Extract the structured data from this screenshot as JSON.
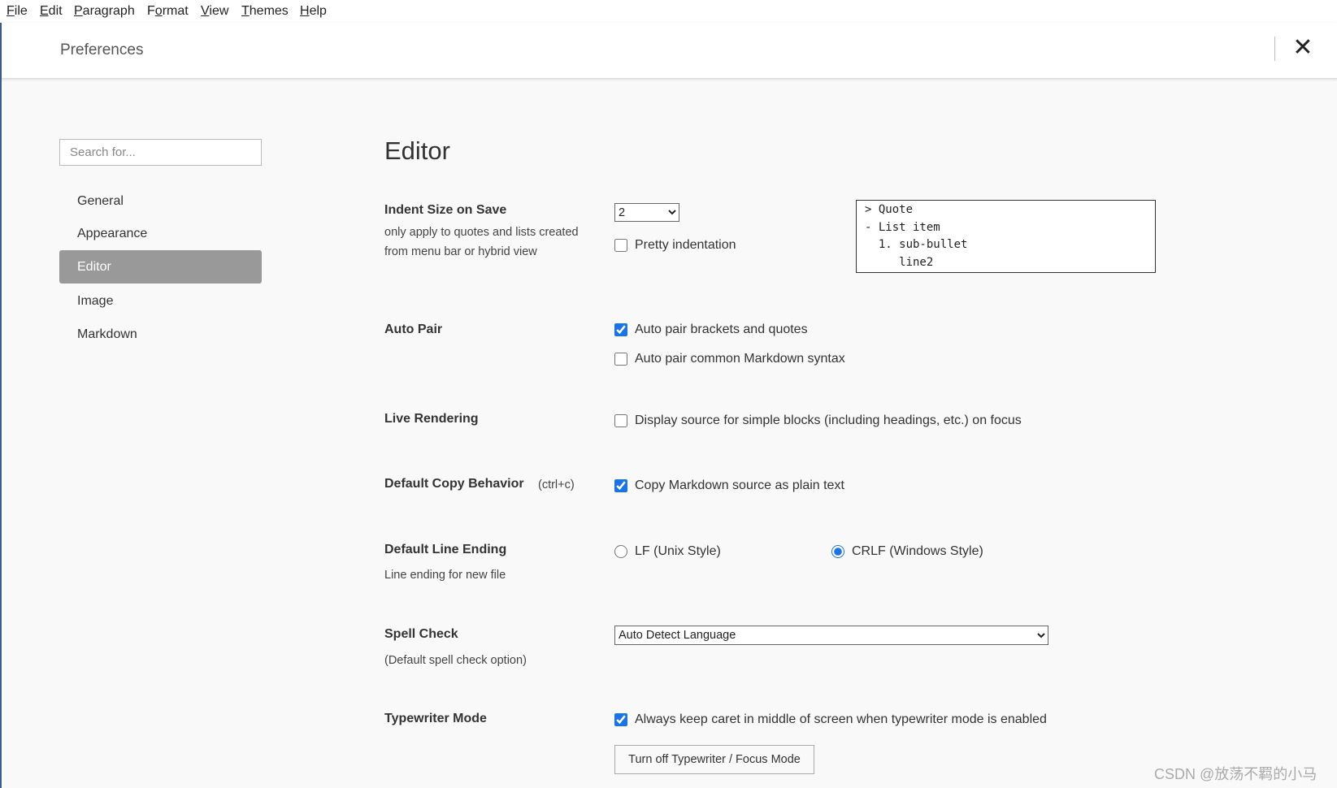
{
  "menubar": {
    "items": [
      {
        "label": "File",
        "accel": "F",
        "rest": "ile"
      },
      {
        "label": "Edit",
        "accel": "E",
        "rest": "dit"
      },
      {
        "label": "Paragraph",
        "accel": "P",
        "rest": "aragraph"
      },
      {
        "label": "Format",
        "pre": "F",
        "accel": "o",
        "rest": "rmat"
      },
      {
        "label": "View",
        "accel": "V",
        "rest": "iew"
      },
      {
        "label": "Themes",
        "accel": "T",
        "rest": "hemes"
      },
      {
        "label": "Help",
        "accel": "H",
        "rest": "elp"
      }
    ]
  },
  "header": {
    "title": "Preferences",
    "close_icon": "close-icon"
  },
  "sidebar": {
    "search_placeholder": "Search for...",
    "items": [
      {
        "label": "General"
      },
      {
        "label": "Appearance"
      },
      {
        "label": "Editor",
        "active": true
      },
      {
        "label": "Image"
      },
      {
        "label": "Markdown"
      }
    ]
  },
  "main": {
    "title": "Editor",
    "indent": {
      "label": "Indent Size on Save",
      "desc1": "only apply to quotes and lists created",
      "desc2": "from menu bar or hybrid view",
      "value": "2",
      "pretty_label": "Pretty indentation",
      "pretty_checked": false,
      "preview": "> Quote\n- List item\n  1. sub-bullet\n     line2"
    },
    "auto_pair": {
      "label": "Auto Pair",
      "opt1": "Auto pair brackets and quotes",
      "opt1_checked": true,
      "opt2": "Auto pair common Markdown syntax",
      "opt2_checked": false
    },
    "live_rendering": {
      "label": "Live Rendering",
      "opt": "Display source for simple blocks (including headings, etc.) on focus",
      "opt_checked": false
    },
    "copy": {
      "label": "Default Copy Behavior",
      "hint": "(ctrl+c)",
      "opt": "Copy Markdown source as plain text",
      "opt_checked": true
    },
    "line_ending": {
      "label": "Default Line Ending",
      "desc": "Line ending for new file",
      "lf": "LF (Unix Style)",
      "crlf": "CRLF (Windows Style)",
      "selected": "crlf"
    },
    "spell": {
      "label": "Spell Check",
      "desc": "(Default spell check option)",
      "value": "Auto Detect Language"
    },
    "typewriter": {
      "label": "Typewriter Mode",
      "opt": "Always keep caret in middle of screen when typewriter mode is enabled",
      "opt_checked": true,
      "button": "Turn off Typewriter / Focus Mode"
    }
  },
  "watermark": "CSDN @放荡不羁的小马",
  "colors": {
    "accent": "#1a73e8",
    "sidebar_active": "#999999"
  }
}
